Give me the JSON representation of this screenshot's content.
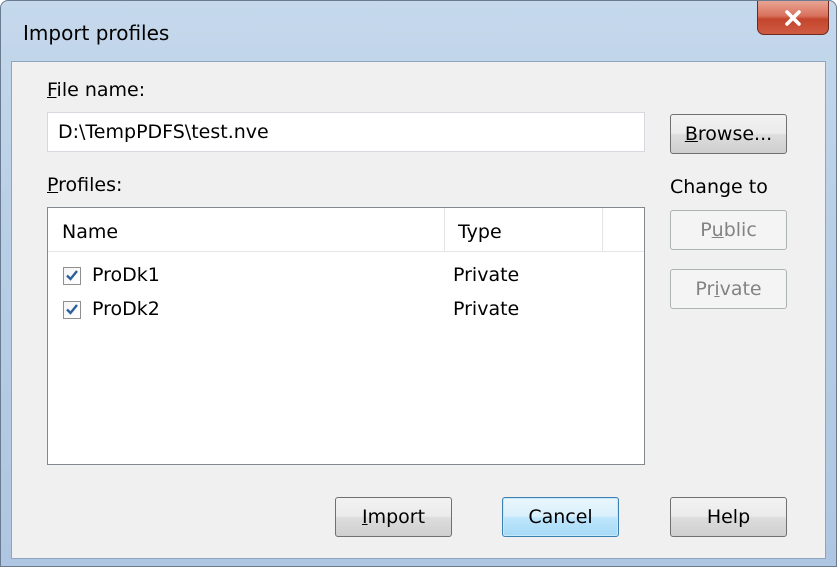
{
  "window": {
    "title": "Import profiles",
    "close_glyph": "close-icon"
  },
  "file_name": {
    "label_accel": "F",
    "label_rest": "ile name:",
    "value": "D:\\TempPDFS\\test.nve"
  },
  "browse_button": {
    "accel": "B",
    "rest": "rowse..."
  },
  "profiles": {
    "label_accel": "P",
    "label_rest": "rofiles:",
    "columns": [
      "Name",
      "Type"
    ],
    "rows": [
      {
        "name": "ProDk1",
        "type": "Private",
        "checked": true
      },
      {
        "name": "ProDk2",
        "type": "Private",
        "checked": true
      }
    ]
  },
  "change_to": {
    "label": "Change to",
    "public_pre": "P",
    "public_accel": "u",
    "public_post": "blic",
    "private_pre": "Pr",
    "private_accel": "i",
    "private_post": "vate"
  },
  "footer": {
    "import_accel": "I",
    "import_rest": "mport",
    "cancel": "Cancel",
    "help": "Help"
  },
  "colors": {
    "frame": "#b9cfe6",
    "close": "#c4452d",
    "default_button": "#3c7fb1",
    "check": "#2b5f9e"
  }
}
